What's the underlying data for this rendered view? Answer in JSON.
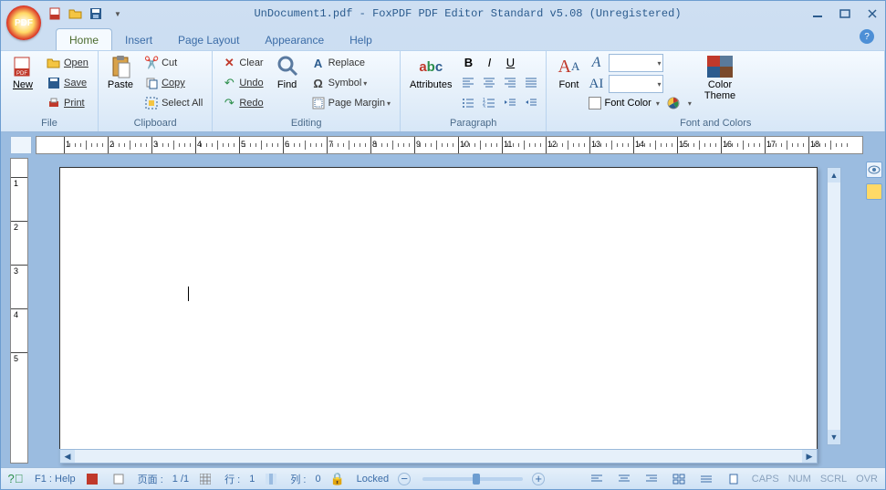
{
  "app_icon_text": "PDF",
  "title": "UnDocument1.pdf - FoxPDF PDF Editor Standard v5.08 (Unregistered)",
  "tabs": {
    "home": "Home",
    "insert": "Insert",
    "page_layout": "Page Layout",
    "appearance": "Appearance",
    "help": "Help"
  },
  "groups": {
    "file": {
      "label": "File",
      "new": "New",
      "open": "Open",
      "save": "Save",
      "print": "Print"
    },
    "clipboard": {
      "label": "Clipboard",
      "paste": "Paste",
      "cut": "Cut",
      "copy": "Copy",
      "select_all": "Select All"
    },
    "editing": {
      "label": "Editing",
      "clear": "Clear",
      "undo": "Undo",
      "redo": "Redo",
      "find": "Find",
      "replace": "Replace",
      "symbol": "Symbol",
      "page_margin": "Page Margin"
    },
    "paragraph": {
      "label": "Paragraph",
      "attributes": "Attributes"
    },
    "font_colors": {
      "label": "Font and Colors",
      "font": "Font",
      "font_color": "Font Color",
      "color_theme": "Color\nTheme"
    }
  },
  "status": {
    "help": "F1 : Help",
    "page_label": "页面 :",
    "page_val": "1 /1",
    "row_label": "行 :",
    "row_val": "1",
    "col_label": "列 :",
    "col_val": "0",
    "locked": "Locked",
    "caps": "CAPS",
    "num": "NUM",
    "scrl": "SCRL",
    "ovr": "OVR"
  },
  "ruler_marks": [
    "1",
    "2",
    "3",
    "4",
    "5",
    "6",
    "7",
    "8",
    "9",
    "10",
    "11",
    "12",
    "13",
    "14",
    "15",
    "16",
    "17",
    "18"
  ],
  "vruler_marks": [
    "1",
    "2",
    "3",
    "4",
    "5"
  ]
}
